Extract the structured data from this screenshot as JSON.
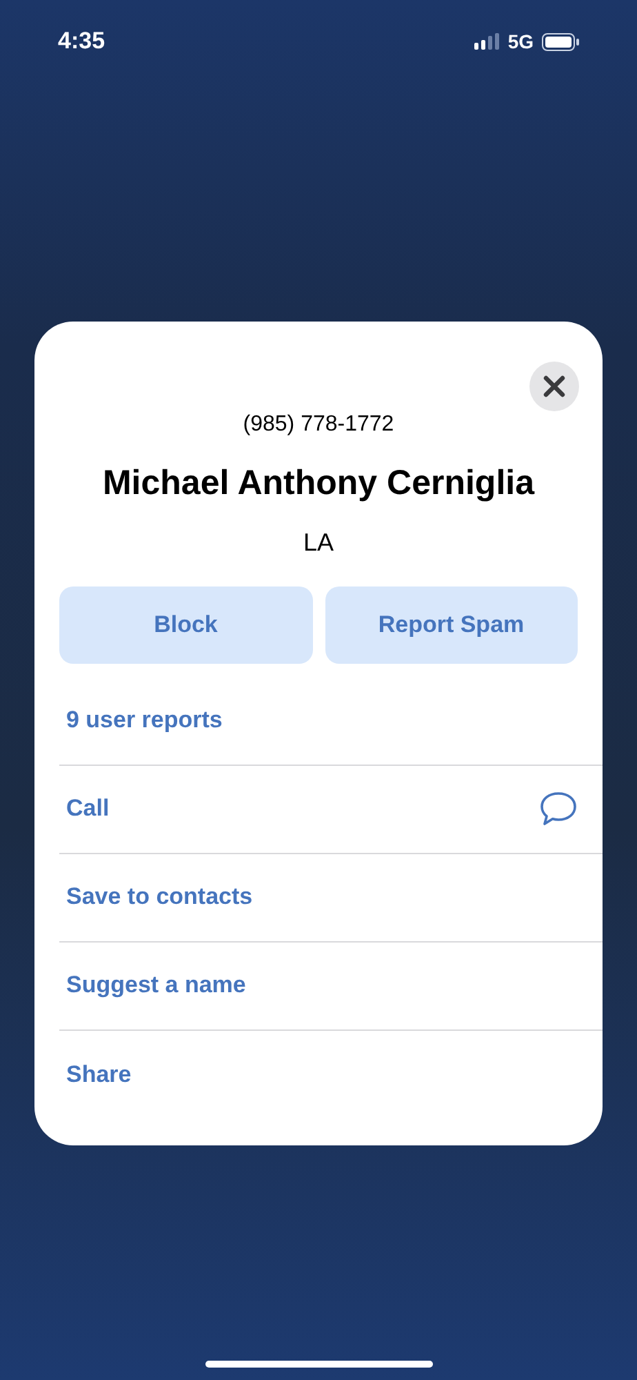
{
  "status_bar": {
    "time": "4:35",
    "network": "5G"
  },
  "card": {
    "phone": "(985) 778-1772",
    "name": "Michael Anthony Cerniglia",
    "location": "LA",
    "buttons": [
      "Block",
      "Report Spam"
    ],
    "rows": [
      {
        "label": "9 user reports",
        "kind": "plain"
      },
      {
        "label": "Call",
        "kind": "message"
      },
      {
        "label": "Save to contacts",
        "kind": "plain"
      },
      {
        "label": "Suggest a name",
        "kind": "plain"
      },
      {
        "label": "Share",
        "kind": "plain"
      }
    ]
  }
}
